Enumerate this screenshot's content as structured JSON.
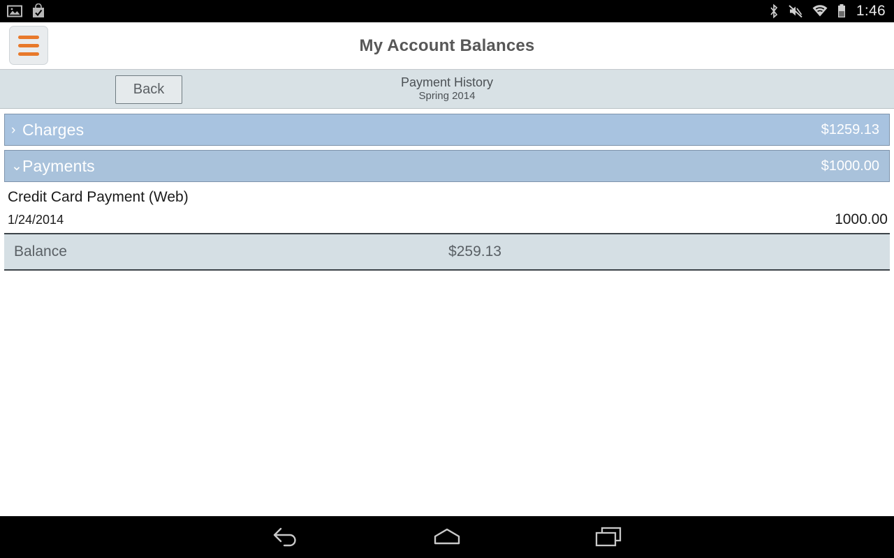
{
  "status_bar": {
    "left_icons": [
      "image-icon",
      "checked-bag-icon"
    ],
    "right_icons": [
      "bluetooth-icon",
      "volume-mute-icon",
      "wifi-icon",
      "battery-icon"
    ],
    "time": "1:46"
  },
  "header": {
    "title": "My Account Balances",
    "menu_icon": "hamburger-menu-icon",
    "menu_accent_color": "#e8792b"
  },
  "sub_header": {
    "back_label": "Back",
    "context_title": "Payment History",
    "context_subtitle": "Spring 2014"
  },
  "sections": [
    {
      "id": "charges",
      "label": "Charges",
      "amount": "$1259.13",
      "expanded": false,
      "chevron": "chevron-right-icon",
      "chevron_glyph": "›",
      "color": "#a8c3e0",
      "items": []
    },
    {
      "id": "payments",
      "label": "Payments",
      "amount": "$1000.00",
      "expanded": true,
      "chevron": "chevron-down-icon",
      "chevron_glyph": "⌄",
      "color": "#a9c2db",
      "items": [
        {
          "description": "Credit Card Payment (Web)",
          "date": "1/24/2014",
          "amount": "1000.00"
        }
      ]
    }
  ],
  "balance": {
    "label": "Balance",
    "amount": "$259.13"
  },
  "nav_bar": {
    "back_icon": "navigation-back-icon",
    "home_icon": "navigation-home-icon",
    "recents_icon": "navigation-recent-apps-icon"
  }
}
